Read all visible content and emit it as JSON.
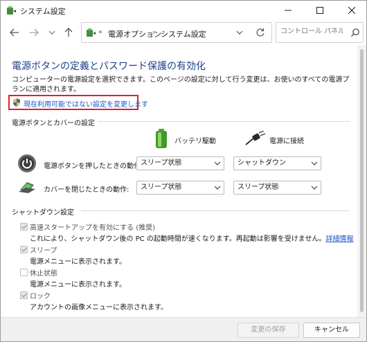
{
  "window": {
    "title": "システム設定"
  },
  "address": {
    "overflow": "«",
    "crumb1": "電源オプション",
    "separator": "›",
    "crumb2": "システム設定"
  },
  "search": {
    "placeholder": "コントロール パネルの..."
  },
  "page": {
    "title": "電源ボタンの定義とパスワード保護の有効化",
    "description": "コンピューターの電源設定を選択できます。このページの設定に対して行う変更は、お使いのすべての電源プランに適用されます。",
    "change_link": "現在利用可能ではない設定を変更します"
  },
  "power_buttons": {
    "group_label": "電源ボタンとカバーの設定",
    "col_battery": "バッテリ駆動",
    "col_plugged": "電源に接続",
    "rows": [
      {
        "label": "電源ボタンを押したときの動作:",
        "battery": "スリープ状態",
        "plugged": "シャットダウン"
      },
      {
        "label": "カバーを閉じたときの動作:",
        "battery": "スリープ状態",
        "plugged": "スリープ状態"
      }
    ]
  },
  "shutdown": {
    "group_label": "シャットダウン設定",
    "items": [
      {
        "label": "高速スタートアップを有効にする (推奨)",
        "sub": "これにより、シャットダウン後の PC の起動時間が速くなります。再起動は影響を受けません。",
        "link": "詳細情報",
        "checked": true
      },
      {
        "label": "スリープ",
        "sub": "電源メニューに表示されます。",
        "checked": true
      },
      {
        "label": "休止状態",
        "sub": "電源メニューに表示されます。",
        "checked": false
      },
      {
        "label": "ロック",
        "sub": "アカウントの画像メニューに表示されます。",
        "checked": true
      }
    ]
  },
  "footer": {
    "save_label": "変更の保存",
    "cancel_label": "キャンセル"
  },
  "colors": {
    "title_blue": "#1e3f8a",
    "link_blue": "#1a56c9",
    "highlight_red": "#e21f26"
  }
}
